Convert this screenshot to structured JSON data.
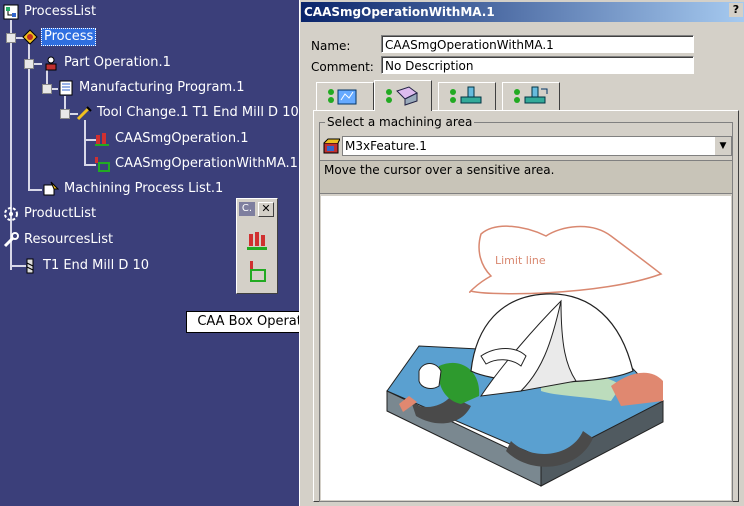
{
  "tree": {
    "items": [
      {
        "label": "ProcessList"
      },
      {
        "label": "Process"
      },
      {
        "label": "Part Operation.1"
      },
      {
        "label": "Manufacturing Program.1"
      },
      {
        "label": "Tool Change.1  T1 End Mill D 10"
      },
      {
        "label": "CAASmgOperation.1"
      },
      {
        "label": "CAASmgOperationWithMA.1"
      },
      {
        "label": "Machining Process List.1"
      },
      {
        "label": "ProductList"
      },
      {
        "label": "ResourcesList"
      },
      {
        "label": "T1 End Mill D 10"
      }
    ]
  },
  "toolbar": {
    "title": "C.",
    "close": "✕"
  },
  "tooltip": "CAA Box Operation",
  "dialog": {
    "title": "CAASmgOperationWithMA.1",
    "help": "?",
    "name_label": "Name:",
    "name_value": "CAASmgOperationWithMA.1",
    "comment_label": "Comment:",
    "comment_value": "No Description",
    "group_label": "Select a machining area",
    "combo_value": "M3xFeature.1",
    "message": "Move the cursor over a sensitive area.",
    "limit_line_label": "Limit line"
  },
  "colors": {
    "tree_bg": "#3b3f7a",
    "dialog_bg": "#d4d0c8",
    "selection": "#2f6fe0",
    "limit_line": "#d98870"
  }
}
